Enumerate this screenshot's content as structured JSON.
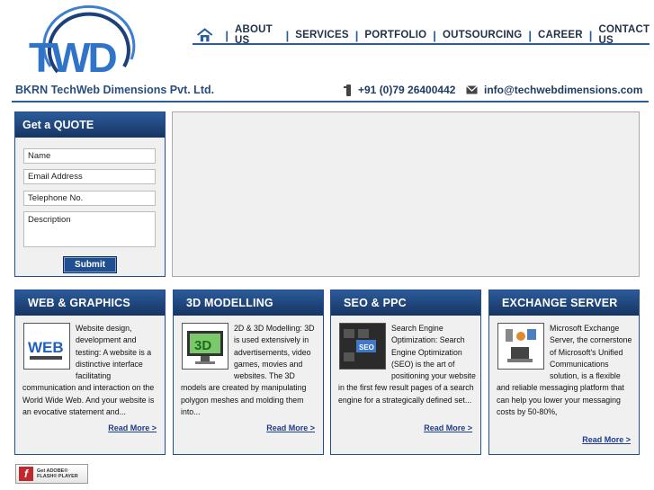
{
  "logo": {
    "text": "TWD"
  },
  "nav": {
    "home_icon": "home-icon",
    "items": [
      "ABOUT US",
      "SERVICES",
      "PORTFOLIO",
      "OUTSOURCING",
      "CAREER",
      "CONTACT US"
    ]
  },
  "company": {
    "name": "BKRN TechWeb Dimensions Pvt. Ltd."
  },
  "contact": {
    "phone": "+91 (0)79 26400442",
    "email": "info@techwebdimensions.com"
  },
  "quote": {
    "title": "Get a QUOTE",
    "name_value": "Name",
    "email_value": "Email Address",
    "phone_value": "Telephone No.",
    "description_value": "Description",
    "submit_label": "Submit"
  },
  "cards": [
    {
      "title": "WEB & GRAPHICS",
      "image_label": "WEB",
      "text": "Website design, development and testing: A website is a distinctive interface facilitating communication and interaction on the World Wide Web. And your website is an evocative statement and...",
      "more": "Read More >"
    },
    {
      "title": "3D MODELLING",
      "image_label": "3D",
      "text": "2D & 3D Modelling: 3D is used extensively in advertisements, video games, movies and websites. The 3D models are created by manipulating polygon meshes and molding them into...",
      "more": "Read More >"
    },
    {
      "title": "SEO & PPC",
      "image_label": "SEO",
      "text": "Search Engine Optimization: Search Engine Optimization (SEO) is the art of positioning your website in the first few result pages of a search engine for a strategically defined set...",
      "more": "Read More >"
    },
    {
      "title": "EXCHANGE SERVER",
      "image_label": "",
      "text": "Microsoft Exchange Server, the cornerstone of Microsoft's Unified Communications solution, is a flexible and reliable messaging platform that can help you lower your messaging costs by 50-80%,",
      "more": "Read More >"
    }
  ],
  "flash": {
    "line1": "Get ADOBE®",
    "line2": "FLASH® PLAYER"
  },
  "colors": {
    "brand_blue": "#1f4f90",
    "nav_text": "#1f3048",
    "panel_bg": "#f0f0f0"
  }
}
